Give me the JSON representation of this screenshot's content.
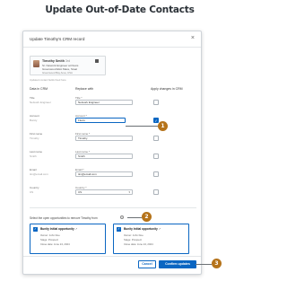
{
  "page": {
    "heading": "Update Out-of-Date Contacts"
  },
  "dialog": {
    "title": "Update Timothy's CRM record",
    "close_glyph": "×",
    "contact": {
      "name": "Timothy Smith",
      "degree": "3rd",
      "headline": "Sr. Network Engineer at Flexis",
      "headline2": "Greenwood Eliot Mace, Stoat",
      "location": "Greenwood Bay Area, USA"
    },
    "updated_note": "Updated contact fields fixed here",
    "columns": {
      "crm": "Data in CRM",
      "replace": "Replace with",
      "apply": "Apply changes in CRM"
    },
    "rows": [
      {
        "label": "Title",
        "old": "Network Engineer",
        "new_label": "Title *",
        "value": "Network Engineer",
        "checked": false
      },
      {
        "label": "Account",
        "old": "Bunity",
        "new_label": "Account *",
        "value": "Flexis",
        "checked": true
      },
      {
        "label": "First name",
        "old": "Timothy",
        "new_label": "First name *",
        "value": "Timothy",
        "checked": false
      },
      {
        "label": "Last name",
        "old": "Smith",
        "new_label": "Last name *",
        "value": "Smith",
        "checked": false
      },
      {
        "label": "Email",
        "old": "tim@email.com",
        "new_label": "Email *",
        "value": "tim@email.com",
        "checked": false
      },
      {
        "label": "Country",
        "old": "US",
        "new_label": "Country *",
        "value": "US",
        "checked": false
      }
    ],
    "opportunities_prompt": "Select the open opportunities to remove Timothy from",
    "opportunities": [
      {
        "title": "Bunity Initial opportunity",
        "owner": "Owner: John Doe",
        "stage": "Stage: Prospect",
        "close": "Close date: June 24, 2024"
      },
      {
        "title": "Bunity Initial opportunity",
        "owner": "Owner: John Doe",
        "stage": "Stage: Prospect",
        "close": "Close date: June 24, 2024"
      }
    ],
    "cancel_label": "Cancel",
    "confirm_label": "Confirm updates"
  },
  "callouts": [
    "1",
    "2",
    "3"
  ],
  "colors": {
    "accent": "#0a66c2",
    "callout": "#b5731a"
  }
}
